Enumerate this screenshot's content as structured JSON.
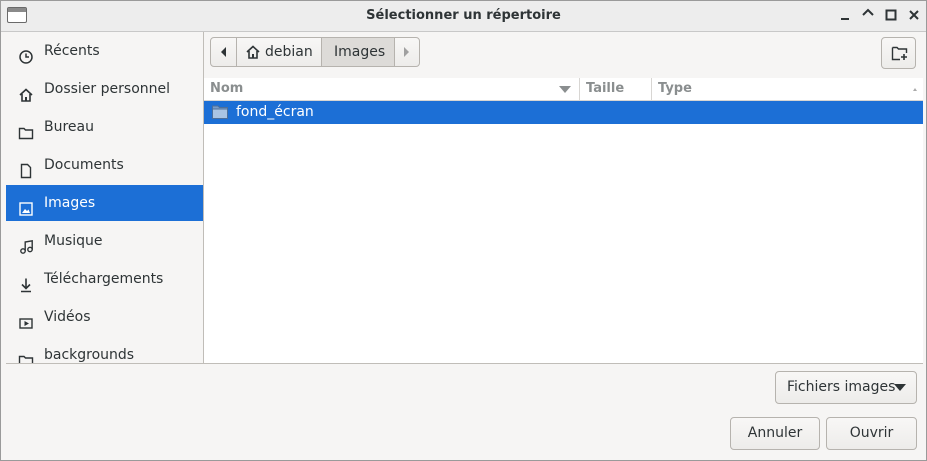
{
  "window": {
    "title": "Sélectionner un répertoire"
  },
  "sidebar": {
    "items": [
      {
        "label": "Récents",
        "icon": "clock-icon"
      },
      {
        "label": "Dossier personnel",
        "icon": "home-icon"
      },
      {
        "label": "Bureau",
        "icon": "folder-icon"
      },
      {
        "label": "Documents",
        "icon": "document-icon"
      },
      {
        "label": "Images",
        "icon": "image-icon",
        "selected": true
      },
      {
        "label": "Musique",
        "icon": "music-icon"
      },
      {
        "label": "Téléchargements",
        "icon": "download-icon"
      },
      {
        "label": "Vidéos",
        "icon": "video-icon"
      },
      {
        "label": "backgrounds",
        "icon": "folder-icon"
      }
    ]
  },
  "pathbar": {
    "segments": [
      {
        "label": "debian",
        "icon": "home-icon"
      },
      {
        "label": "Images"
      }
    ]
  },
  "file_list": {
    "columns": {
      "name": "Nom",
      "size": "Taille",
      "type": "Type"
    },
    "rows": [
      {
        "name": "fond_écran",
        "icon": "folder-icon",
        "selected": true
      }
    ]
  },
  "filter": {
    "selected": "Fichiers images"
  },
  "actions": {
    "cancel_label": "Annuler",
    "open_label": "Ouvrir"
  },
  "colors": {
    "accent": "#1c6fd6",
    "background": "#f6f5f4"
  }
}
